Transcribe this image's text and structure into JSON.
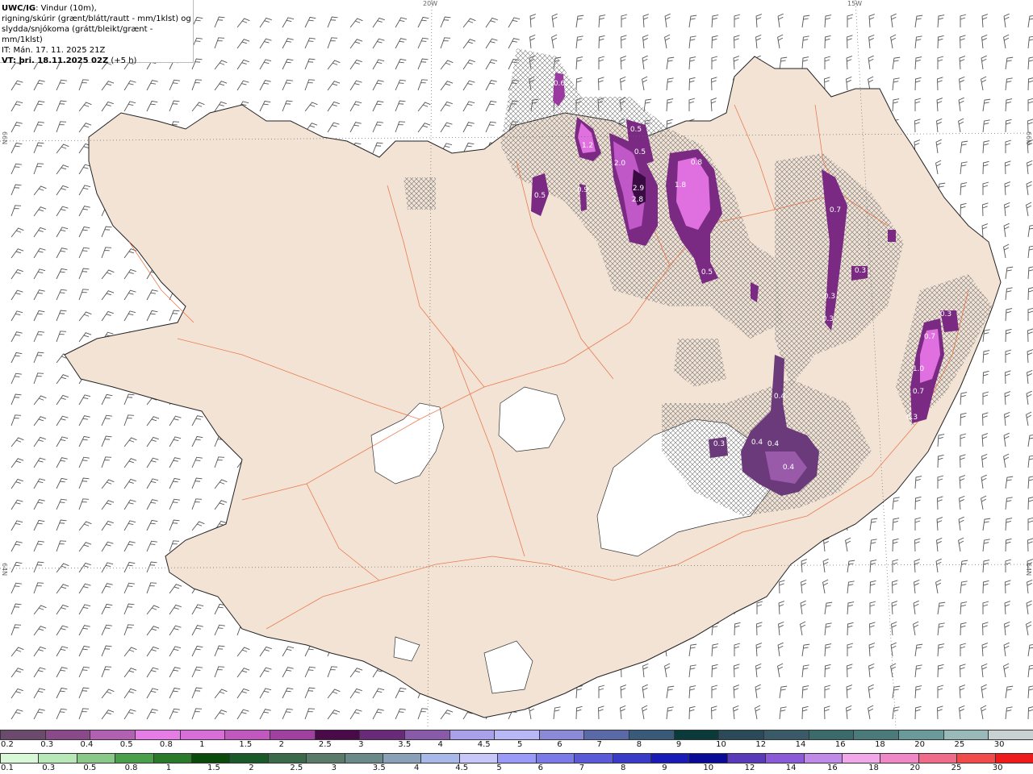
{
  "header": {
    "model": "UWC/IG",
    "line1": ": Vindur (10m),",
    "line2": "rigning/skúrir (grænt/blátt/rautt - mm/1klst) og",
    "line3": "slydda/snjókoma (grátt/bleikt/grænt - mm/1klst)",
    "it": "IT: Mán. 17. 11. 2025 21Z",
    "vt": "VT: þri. 18.11.2025 02Z",
    "lead": "(+5 h)"
  },
  "grid_labels": {
    "lon_20w": "20W",
    "lon_15w": "15W",
    "lat_66n_left": "66N",
    "lat_66n_right": "66N",
    "lat_64n_left": "64N",
    "lat_64n_right": "64N"
  },
  "precip_labels": [
    "0.6",
    "1.2",
    "0.5",
    "0.5",
    "2.0",
    "0.9",
    "2.9",
    "2.8",
    "1.8",
    "0.5",
    "0.8",
    "0.7",
    "0.3",
    "0.3",
    "0.3",
    "0.3",
    "0.7",
    "1.0",
    "0.7",
    "0.3",
    "0.4",
    "0.4",
    "0.4",
    "0.4",
    "0.3",
    "0.5"
  ],
  "legend": {
    "snow_colors": [
      "#6b4a6e",
      "#8a4a8a",
      "#b260b2",
      "#e67de6",
      "#d86fd8",
      "#c058c0",
      "#a040a0",
      "#4a0a4a",
      "#6a2a7a",
      "#8a5aaa",
      "#a8a0e8",
      "#b8b8f8",
      "#8a8ad8",
      "#5a6aa8",
      "#3a5a7a",
      "#0a3a3a",
      "#2a4a5a",
      "#3a5a6a",
      "#3a6a6a",
      "#4a7a7a",
      "#6a9a9a",
      "#9ababa",
      "#c8d2d2"
    ],
    "snow_ticks": [
      "0.2",
      "0.3",
      "0.4",
      "0.5",
      "0.8",
      "1",
      "1.5",
      "2",
      "2.5",
      "3",
      "3.5",
      "4",
      "4.5",
      "5",
      "6",
      "7",
      "8",
      "9",
      "10",
      "12",
      "14",
      "16",
      "18",
      "20",
      "25",
      "30"
    ],
    "rain_colors": [
      "#d8f8d8",
      "#b8e8b8",
      "#8ac88a",
      "#4aa04a",
      "#2a7a2a",
      "#0a4a0a",
      "#1a5a2a",
      "#3a6a4a",
      "#5a7a6a",
      "#6a8a8a",
      "#8aa0b8",
      "#a8b8e8",
      "#c8c8f8",
      "#9a9af8",
      "#7a7ae8",
      "#5a5ad8",
      "#3a3ac8",
      "#1a1ab8",
      "#0a0a98",
      "#5a3ab8",
      "#8a5ad8",
      "#c08ae8",
      "#f0a8e8",
      "#f088c8",
      "#f06a8a",
      "#f04a4a",
      "#f01a1a"
    ],
    "rain_ticks": [
      "0.1",
      "0.3",
      "0.5",
      "0.8",
      "1",
      "1.5",
      "2",
      "2.5",
      "3",
      "3.5",
      "4",
      "4.5",
      "5",
      "6",
      "7",
      "8",
      "9",
      "10",
      "12",
      "14",
      "16",
      "18",
      "20",
      "25",
      "30"
    ]
  }
}
